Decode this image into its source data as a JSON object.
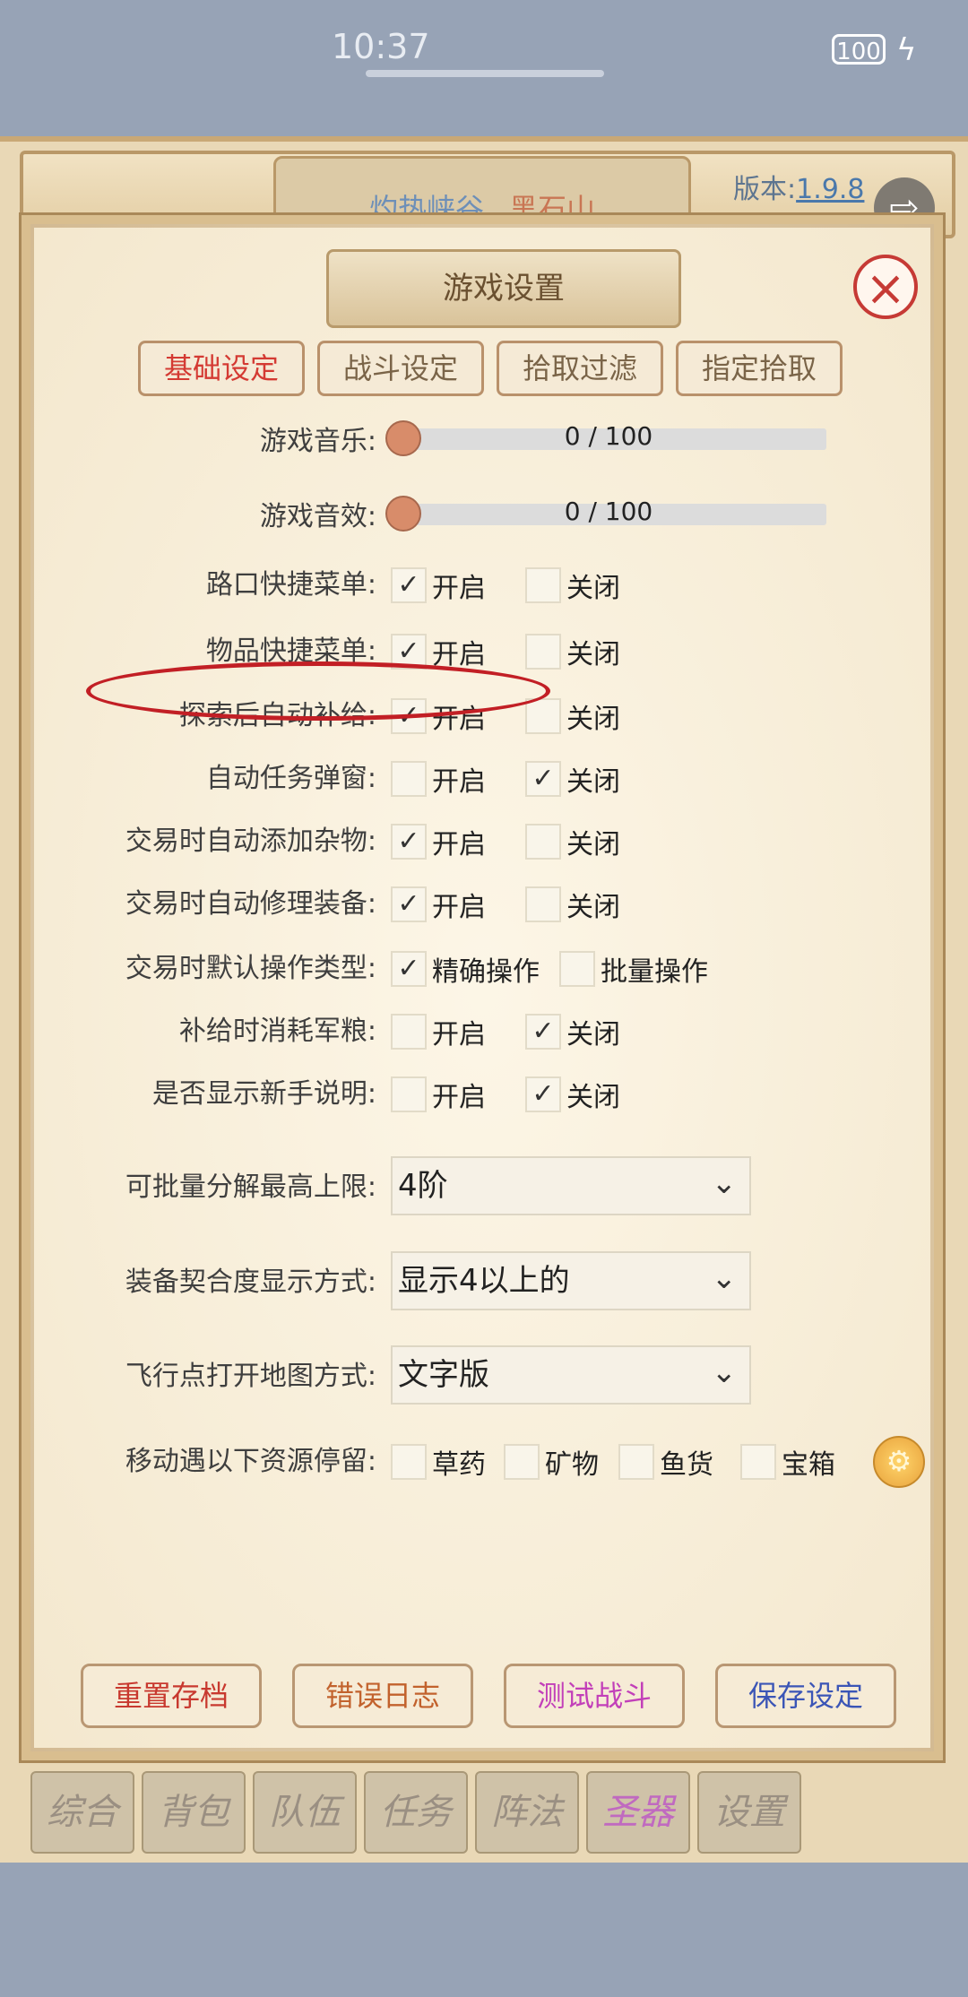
{
  "status": {
    "time": "10:37",
    "battery": "100"
  },
  "game": {
    "map_a": "灼热峡谷",
    "map_b": "黑石山",
    "version_label": "版本:",
    "version_value": "1.9.8",
    "bottom_tabs": [
      "综合",
      "背包",
      "队伍",
      "任务",
      "阵法",
      "圣器",
      "设置"
    ],
    "active_bottom_tab": "圣器"
  },
  "dialog": {
    "title": "游戏设置",
    "subtabs": [
      "基础设定",
      "战斗设定",
      "拾取过滤",
      "指定拾取"
    ],
    "sliders": [
      {
        "label": "游戏音乐:",
        "value": "0 / 100"
      },
      {
        "label": "游戏音效:",
        "value": "0 / 100"
      }
    ],
    "toggles": [
      {
        "label": "路口快捷菜单:",
        "on": "开启",
        "off": "关闭",
        "on_checked": true
      },
      {
        "label": "物品快捷菜单:",
        "on": "开启",
        "off": "关闭",
        "on_checked": true
      },
      {
        "label": "探索后自动补给:",
        "on": "开启",
        "off": "关闭",
        "on_checked": true
      },
      {
        "label": "自动任务弹窗:",
        "on": "开启",
        "off": "关闭",
        "on_checked": false
      },
      {
        "label": "交易时自动添加杂物:",
        "on": "开启",
        "off": "关闭",
        "on_checked": true
      },
      {
        "label": "交易时自动修理装备:",
        "on": "开启",
        "off": "关闭",
        "on_checked": true
      },
      {
        "label": "交易时默认操作类型:",
        "on": "精确操作",
        "off": "批量操作",
        "on_checked": true
      },
      {
        "label": "补给时消耗军粮:",
        "on": "开启",
        "off": "关闭",
        "on_checked": false
      },
      {
        "label": "是否显示新手说明:",
        "on": "开启",
        "off": "关闭",
        "on_checked": false
      }
    ],
    "selects": [
      {
        "label": "可批量分解最高上限:",
        "value": "4阶"
      },
      {
        "label": "装备契合度显示方式:",
        "value": "显示4以上的"
      },
      {
        "label": "飞行点打开地图方式:",
        "value": "文字版"
      }
    ],
    "resources": {
      "label": "移动遇以下资源停留:",
      "items": [
        "草药",
        "矿物",
        "鱼货",
        "宝箱"
      ]
    },
    "actions": [
      {
        "label": "重置存档",
        "color": "#c8392f"
      },
      {
        "label": "错误日志",
        "color": "#c2622d"
      },
      {
        "label": "测试战斗",
        "color": "#c23fb9"
      },
      {
        "label": "保存设定",
        "color": "#3b55b6"
      }
    ]
  },
  "icons": {
    "close": "close-icon",
    "exit": "exit-icon",
    "gear": "gear-icon",
    "chevron": "chevron-down-icon",
    "check": "check-icon"
  }
}
